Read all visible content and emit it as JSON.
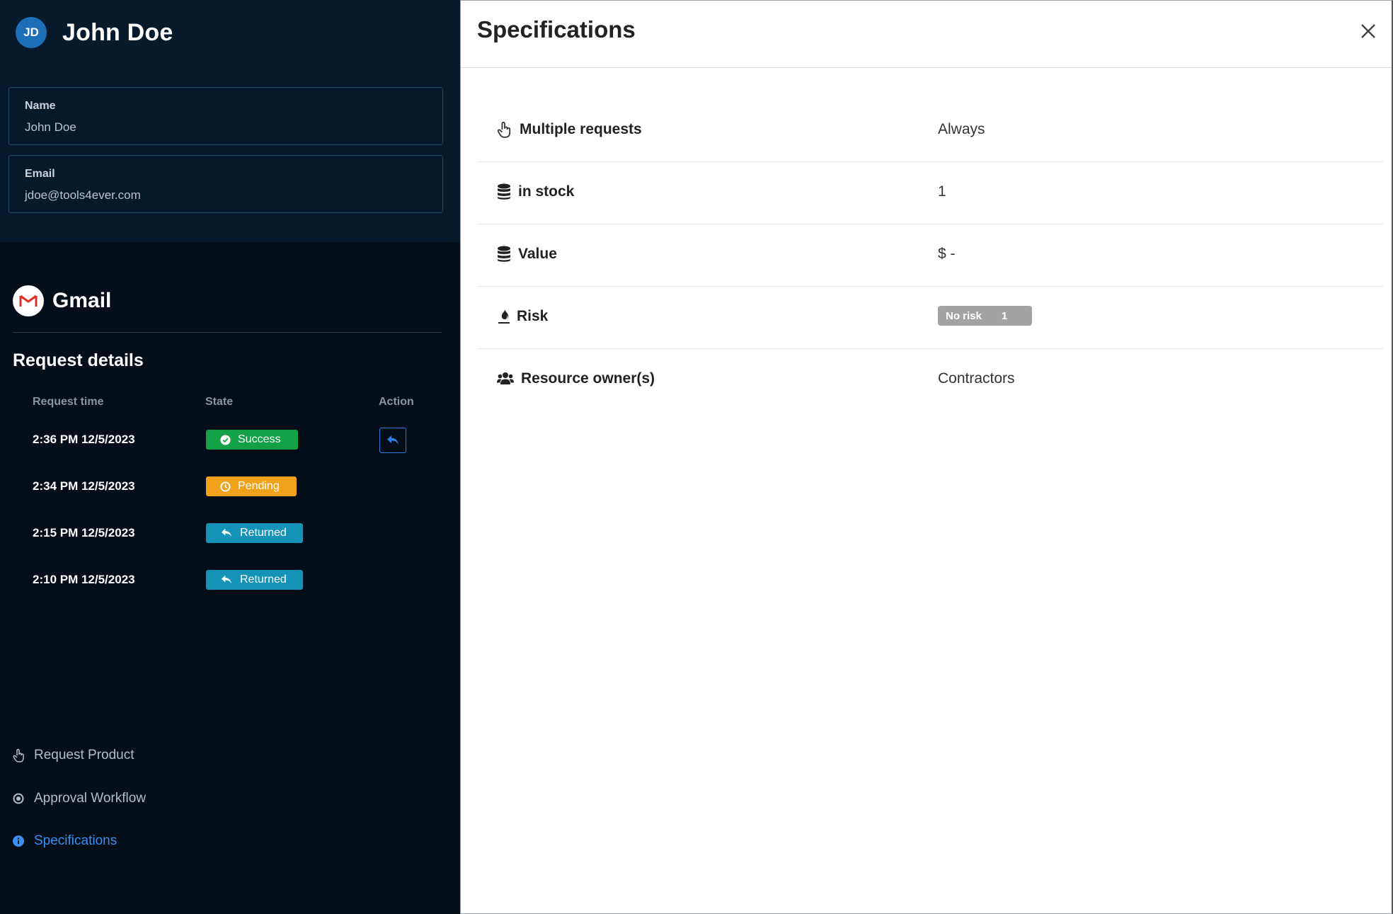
{
  "user": {
    "initials": "JD",
    "name": "John Doe",
    "fields": [
      {
        "label": "Name",
        "value": "John Doe"
      },
      {
        "label": "Email",
        "value": "jdoe@tools4ever.com"
      }
    ]
  },
  "app": {
    "name": "Gmail",
    "icon": "gmail-logo"
  },
  "request_details": {
    "title": "Request details",
    "columns": [
      "Request time",
      "State",
      "Action"
    ],
    "rows": [
      {
        "time": "2:36 PM 12/5/2023",
        "state": "Success",
        "state_icon": "check-circle-icon",
        "color": "#12a146",
        "has_action": true
      },
      {
        "time": "2:34 PM 12/5/2023",
        "state": "Pending",
        "state_icon": "clock-icon",
        "color": "#f0a21a",
        "has_action": false
      },
      {
        "time": "2:15 PM 12/5/2023",
        "state": "Returned",
        "state_icon": "return-icon",
        "color": "#1592b7",
        "has_action": false
      },
      {
        "time": "2:10 PM 12/5/2023",
        "state": "Returned",
        "state_icon": "return-icon",
        "color": "#1592b7",
        "has_action": false
      }
    ],
    "action_icon": "return-arrow-icon"
  },
  "nav": [
    {
      "label": "Request Product",
      "icon": "hand-pointer-icon",
      "active": false
    },
    {
      "label": "Approval Workflow",
      "icon": "dot-circle-icon",
      "active": false
    },
    {
      "label": "Specifications",
      "icon": "info-circle-icon",
      "active": true
    }
  ],
  "specifications": {
    "title": "Specifications",
    "close_icon": "close-icon",
    "rows": [
      {
        "label": "Multiple requests",
        "icon": "hand-pointer-icon",
        "value": "Always"
      },
      {
        "label": "in stock",
        "icon": "database-icon",
        "value": "1"
      },
      {
        "label": "Value",
        "icon": "database-icon",
        "value": "$ -"
      },
      {
        "label": "Risk",
        "icon": "fire-icon",
        "value": "",
        "badge_text": "No risk",
        "badge_count": "1"
      },
      {
        "label": "Resource owner(s)",
        "icon": "users-icon",
        "value": "Contractors"
      }
    ]
  },
  "colors": {
    "accent_blue": "#3b8ff0",
    "panel_dark": "#030e18",
    "success": "#12a146",
    "pending": "#f0a21a",
    "returned": "#1592b7",
    "risk_badge": "#a3a3a3"
  }
}
